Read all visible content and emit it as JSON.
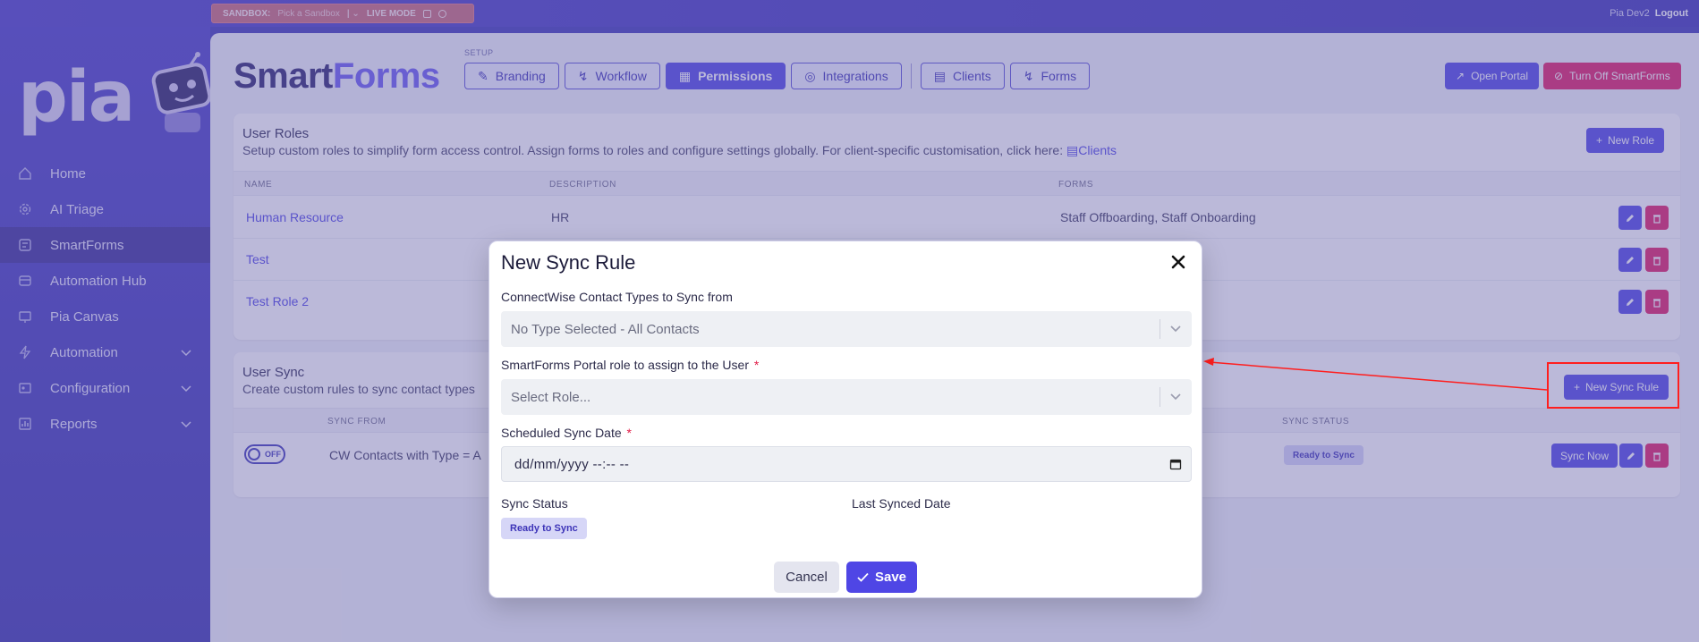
{
  "topbar": {
    "sandbox_label": "SANDBOX:",
    "sandbox_placeholder": "Pick a Sandbox",
    "live_mode": "LIVE MODE",
    "user_name": "Pia Dev2",
    "logout": "Logout"
  },
  "sidebar": {
    "logo": "pia",
    "items": [
      {
        "label": "Home",
        "icon": "home-icon"
      },
      {
        "label": "AI Triage",
        "icon": "gear-icon"
      },
      {
        "label": "SmartForms",
        "icon": "forms-icon"
      },
      {
        "label": "Automation Hub",
        "icon": "automation-hub-icon"
      },
      {
        "label": "Pia Canvas",
        "icon": "canvas-icon"
      },
      {
        "label": "Automation",
        "icon": "bolt-icon"
      },
      {
        "label": "Configuration",
        "icon": "sliders-icon"
      },
      {
        "label": "Reports",
        "icon": "reports-icon"
      }
    ]
  },
  "header": {
    "brand_a": "Smart",
    "brand_b": "Forms",
    "setup_label": "SETUP",
    "tabs": [
      "Branding",
      "Workflow",
      "Permissions",
      "Integrations",
      "Clients",
      "Forms"
    ],
    "active_tab": "Permissions",
    "open_portal": "Open Portal",
    "turn_off": "Turn Off SmartForms"
  },
  "roles": {
    "title": "User Roles",
    "subtitle": "Setup custom roles to simplify form access control. Assign forms to roles and configure settings globally. For client-specific customisation, click here:",
    "subtitle_link": "Clients",
    "new_button": "New Role",
    "columns": [
      "NAME",
      "DESCRIPTION",
      "FORMS"
    ],
    "rows": [
      {
        "name": "Human Resource",
        "description": "HR",
        "forms": "Staff Offboarding, Staff Onboarding"
      },
      {
        "name": "Test",
        "description": "",
        "forms": ""
      },
      {
        "name": "Test Role 2",
        "description": "",
        "forms": ""
      }
    ]
  },
  "sync": {
    "title": "User Sync",
    "subtitle": "Create custom rules to sync contact types",
    "new_button": "New Sync Rule",
    "columns": [
      "SYNC FROM",
      "SYNC STATUS"
    ],
    "row": {
      "toggle": "OFF",
      "sync_from": "CW Contacts with Type = A",
      "status": "Ready to Sync",
      "sync_now": "Sync Now"
    }
  },
  "modal": {
    "title": "New Sync Rule",
    "contact_types_label": "ConnectWise Contact Types to Sync from",
    "contact_types_value": "No Type Selected - All Contacts",
    "role_label": "SmartForms Portal role to assign to the User",
    "role_placeholder": "Select Role...",
    "date_label": "Scheduled Sync Date",
    "date_value": "dd/mm/yyyy --:-- --",
    "required_mark": "*",
    "sync_status_label": "Sync Status",
    "sync_status_value": "Ready to Sync",
    "last_synced_label": "Last Synced Date",
    "cancel": "Cancel",
    "save": "Save"
  },
  "colors": {
    "primary": "#4f46e5",
    "danger": "#e11d64",
    "sidebar": "#3f3ab8",
    "annotation": "#ff1e1e"
  }
}
